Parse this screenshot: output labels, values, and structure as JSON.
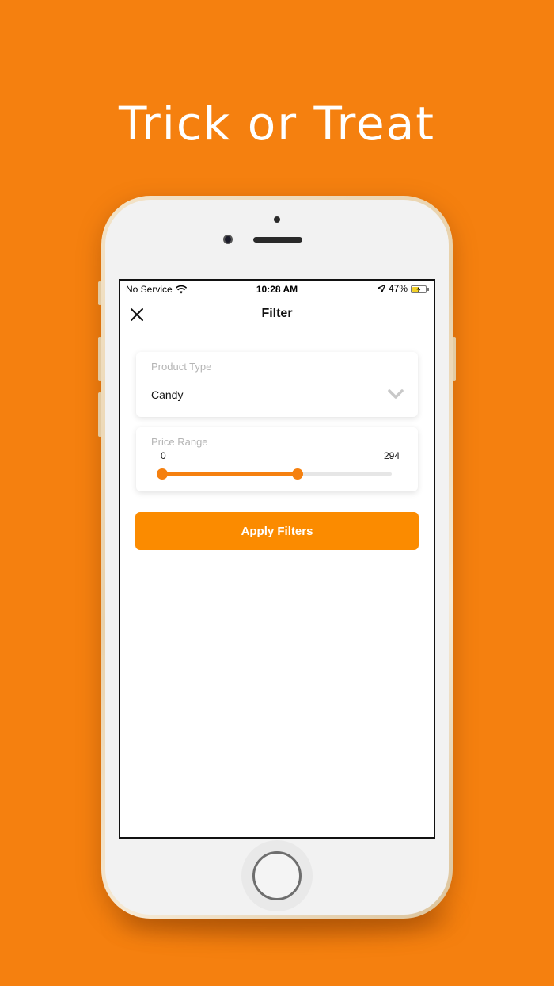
{
  "headline": "Trick or Treat",
  "colors": {
    "background": "#f5800f",
    "accent": "#fb8b00",
    "battery": "#f2d027"
  },
  "status_bar": {
    "carrier": "No Service",
    "time": "10:28 AM",
    "battery_percent": "47%",
    "icons": [
      "wifi-icon",
      "location-arrow-icon",
      "battery-charging-icon"
    ]
  },
  "nav": {
    "title": "Filter",
    "close_icon": "close-icon"
  },
  "product_type": {
    "label": "Product Type",
    "value": "Candy",
    "icon": "chevron-down-icon"
  },
  "price_range": {
    "label": "Price Range",
    "min": "0",
    "max": "294",
    "lower_fraction": 0,
    "upper_fraction": 0.59
  },
  "apply_button": {
    "label": "Apply Filters"
  }
}
